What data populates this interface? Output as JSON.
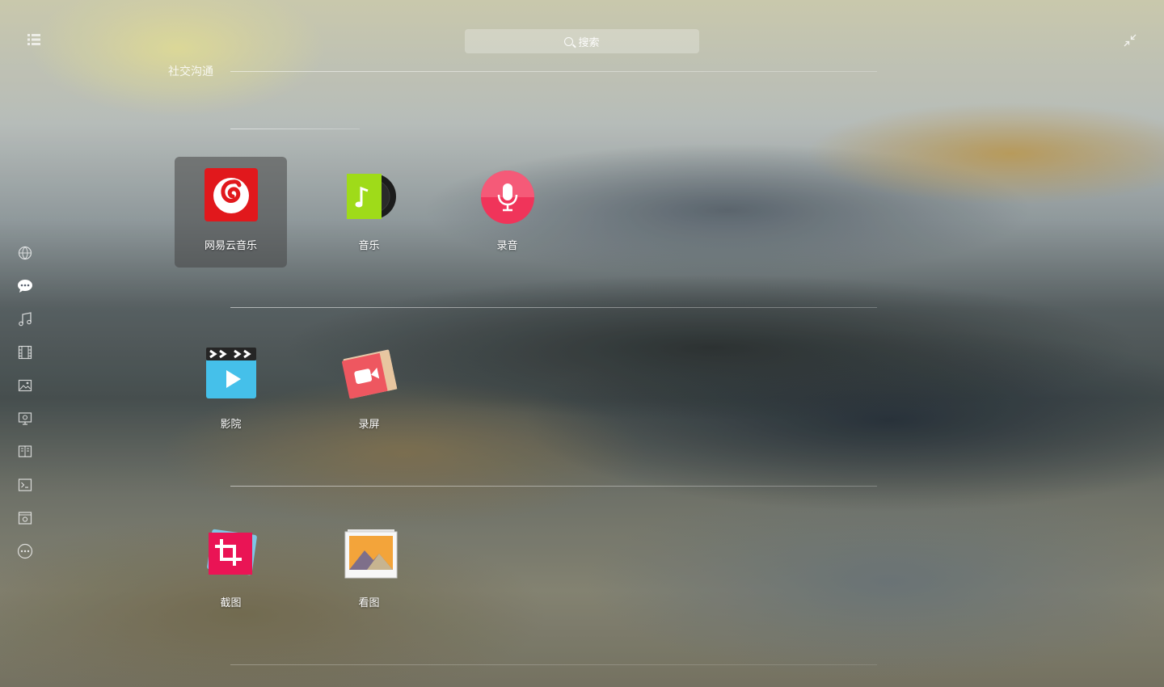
{
  "search": {
    "label": "搜索"
  },
  "category": {
    "title": "社交沟通"
  },
  "sidebar": {
    "items": [
      {
        "name": "internet-icon"
      },
      {
        "name": "chat-icon",
        "active": true
      },
      {
        "name": "music-icon"
      },
      {
        "name": "video-icon"
      },
      {
        "name": "image-icon"
      },
      {
        "name": "game-icon"
      },
      {
        "name": "reading-icon"
      },
      {
        "name": "terminal-icon"
      },
      {
        "name": "system-icon"
      },
      {
        "name": "more-icon"
      }
    ]
  },
  "apps": [
    {
      "label": "网易云音乐",
      "icon": "netease-music-icon",
      "selected": true
    },
    {
      "label": "音乐",
      "icon": "music-player-icon"
    },
    {
      "label": "录音",
      "icon": "voice-recorder-icon"
    },
    {
      "label": "影院",
      "icon": "movie-player-icon"
    },
    {
      "label": "录屏",
      "icon": "screen-recorder-icon"
    },
    {
      "label": "截图",
      "icon": "screenshot-icon"
    },
    {
      "label": "看图",
      "icon": "image-viewer-icon"
    }
  ],
  "colors": {
    "netease": "#e1181c",
    "music_green": "#9fdb19",
    "recorder_pink": "#f0345a",
    "movie_blue": "#45c0ea",
    "screen_rec": "#ee5760",
    "screenshot": "#ea1455",
    "viewer_orange": "#f3a43a"
  }
}
